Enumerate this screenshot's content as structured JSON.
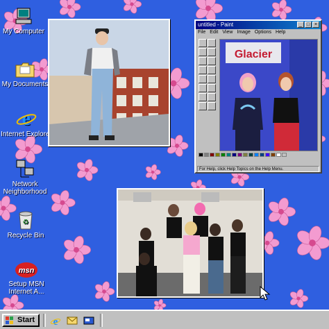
{
  "desktop_icons": [
    {
      "label": "My Computer",
      "icon": "computer-icon"
    },
    {
      "label": "My Documents",
      "icon": "folder-icon"
    },
    {
      "label": "Internet Explorer",
      "icon": "ie-icon"
    },
    {
      "label": "Network Neighborhood",
      "icon": "network-icon"
    },
    {
      "label": "Recycle Bin",
      "icon": "recycle-bin-icon"
    },
    {
      "label": "Setup MSN Internet A...",
      "icon": "msn-icon"
    }
  ],
  "paint": {
    "title": "untitled - Paint",
    "menu": [
      "File",
      "Edit",
      "View",
      "Image",
      "Options",
      "Help"
    ],
    "status": "For Help, click Help Topics on the Help Menu.",
    "canvas_sign": "Glacier",
    "palette": [
      "#000000",
      "#808080",
      "#800000",
      "#808000",
      "#008000",
      "#008080",
      "#000080",
      "#800080",
      "#808040",
      "#004040",
      "#0080ff",
      "#004080",
      "#4000ff",
      "#804000",
      "#ffffff",
      "#c0c0c0"
    ]
  },
  "taskbar": {
    "start_label": "Start"
  },
  "colors": {
    "desktop": "#2f5fe0",
    "flower": "#f39bd0",
    "flower_center": "#d64a8f"
  }
}
